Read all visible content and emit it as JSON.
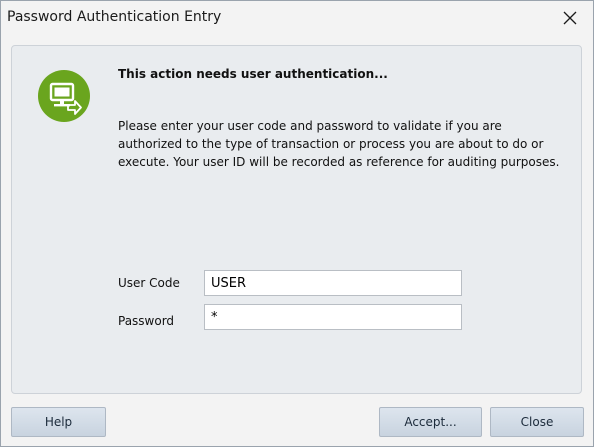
{
  "window": {
    "title": "Password Authentication Entry"
  },
  "message": {
    "heading": "This action needs user authentication...",
    "body": "Please enter your user code and password to validate if you are authorized to the type of transaction or process you are about to do or execute. Your user ID will be recorded as reference for auditing purposes."
  },
  "form": {
    "user_code_label": "User Code",
    "user_code_value": "USER",
    "password_label": "Password",
    "password_value": "*"
  },
  "buttons": {
    "help": "Help",
    "accept": "Accept...",
    "close": "Close"
  },
  "icons": {
    "close": "close-icon",
    "auth": "computer-user-icon"
  },
  "colors": {
    "icon_green": "#6aa51e",
    "panel_bg": "#e9ecef",
    "button_bg": "#d3dce6"
  }
}
